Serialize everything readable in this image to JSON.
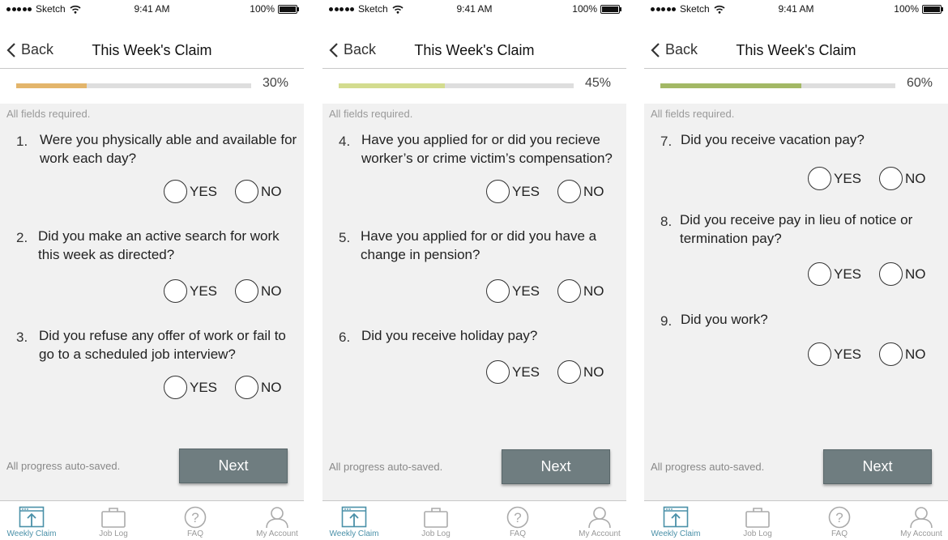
{
  "status_bar": {
    "carrier": "Sketch",
    "time": "9:41 AM",
    "battery": "100%"
  },
  "nav": {
    "back_label": "Back",
    "title": "This Week's Claim"
  },
  "required_note": "All fields required.",
  "autosave_note": "All progress auto-saved.",
  "next_label": "Next",
  "option_labels": {
    "yes": "YES",
    "no": "NO"
  },
  "tabs": [
    {
      "label": "Weekly Claim",
      "icon": "weekly-claim-icon",
      "active": true
    },
    {
      "label": "Job Log",
      "icon": "briefcase-icon",
      "active": false
    },
    {
      "label": "FAQ",
      "icon": "help-icon",
      "active": false
    },
    {
      "label": "My Account",
      "icon": "user-icon",
      "active": false
    }
  ],
  "colors": {
    "accent_tab": "#4a90a8",
    "next_button": "#6f7d80",
    "track": "#dedede"
  },
  "screens": [
    {
      "progress_label": "30%",
      "progress_value": 0.3,
      "progress_color": "#e3b56b",
      "questions": [
        {
          "number": "1.",
          "text": "Were you physically able and available for work each day?"
        },
        {
          "number": "2.",
          "text": "Did you make an active search for work this week as directed?"
        },
        {
          "number": "3.",
          "text": "Did you refuse any offer of work or fail to go to a scheduled job interview?"
        }
      ]
    },
    {
      "progress_label": "45%",
      "progress_value": 0.45,
      "progress_color": "#d3dc8f",
      "questions": [
        {
          "number": "4.",
          "text": "Have you applied for or did you recieve worker’s or crime victim’s compensation?"
        },
        {
          "number": "5.",
          "text": "Have you applied for or did you have a change in pension?"
        },
        {
          "number": "6.",
          "text": "Did you receive holiday pay?"
        }
      ]
    },
    {
      "progress_label": "60%",
      "progress_value": 0.6,
      "progress_color": "#a3b865",
      "questions": [
        {
          "number": "7.",
          "text": "Did you receive vacation pay?"
        },
        {
          "number": "8.",
          "text": "Did you receive pay in lieu of notice or termination pay?"
        },
        {
          "number": "9.",
          "text": "Did you work?"
        }
      ]
    }
  ]
}
